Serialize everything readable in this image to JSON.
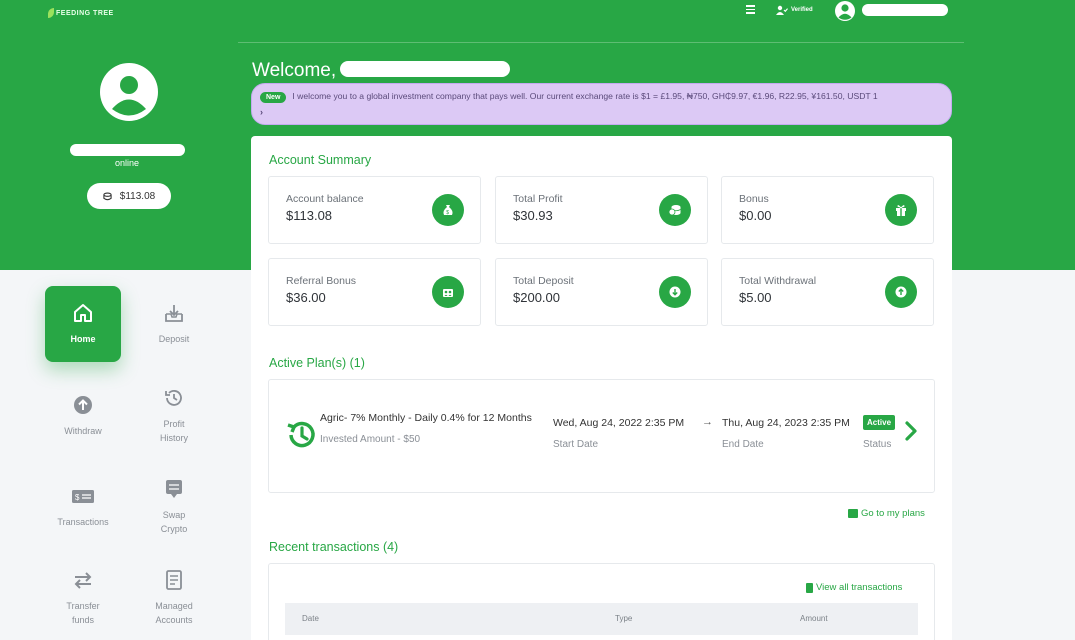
{
  "colors": {
    "brand": "#28a745",
    "notice_bg": "#dcc9f5",
    "text": "#3d3d3d"
  },
  "header": {
    "logo_text": "FEEDING TREE",
    "menu_icon": "menu-icon",
    "verified_label": "Verified"
  },
  "profile": {
    "status": "online",
    "balance": "$113.08"
  },
  "sidebar": {
    "items": [
      {
        "label": "Home",
        "icon": "home-icon",
        "active": true
      },
      {
        "label": "Deposit",
        "icon": "deposit-icon"
      },
      {
        "label": "Withdraw",
        "icon": "withdraw-icon"
      },
      {
        "label": "Profit History",
        "icon": "history-icon"
      },
      {
        "label": "Transactions",
        "icon": "cash-icon"
      },
      {
        "label": "Swap Crypto",
        "icon": "swap-icon"
      },
      {
        "label": "Transfer funds",
        "icon": "transfer-icon"
      },
      {
        "label": "Managed Accounts",
        "icon": "document-icon"
      }
    ]
  },
  "main": {
    "welcome": "Welcome,",
    "notice": {
      "badge": "New",
      "text": "I welcome you to a global investment company that pays well. Our current exchange rate is $1 = £1.95, ₦750, GH₵9.97, €1.96, R22.95, ¥161.50, USDT 1"
    },
    "account_summary": {
      "title": "Account Summary",
      "stats": [
        {
          "label": "Account balance",
          "value": "$113.08",
          "icon": "money-bag-icon"
        },
        {
          "label": "Total Profit",
          "value": "$30.93",
          "icon": "coins-icon"
        },
        {
          "label": "Bonus",
          "value": "$0.00",
          "icon": "gift-icon"
        },
        {
          "label": "Referral Bonus",
          "value": "$36.00",
          "icon": "people-icon"
        },
        {
          "label": "Total Deposit",
          "value": "$200.00",
          "icon": "arrow-down-icon"
        },
        {
          "label": "Total Withdrawal",
          "value": "$5.00",
          "icon": "arrow-up-icon"
        }
      ]
    },
    "active_plans": {
      "title": "Active Plan(s) (1)",
      "plan": {
        "name": "Agric- 7% Monthly - Daily 0.4% for 12 Months",
        "invested": "Invested Amount - $50",
        "start_date": "Wed, Aug 24, 2022 2:35 PM",
        "start_label": "Start Date",
        "arrow": "→",
        "end_date": "Thu, Aug 24, 2023 2:35 PM",
        "end_label": "End Date",
        "status": "Active",
        "status_label": "Status"
      },
      "link": "Go to my plans"
    },
    "recent_transactions": {
      "title": "Recent transactions (4)",
      "link": "View all transactions",
      "columns": [
        "Date",
        "Type",
        "Amount"
      ]
    }
  }
}
